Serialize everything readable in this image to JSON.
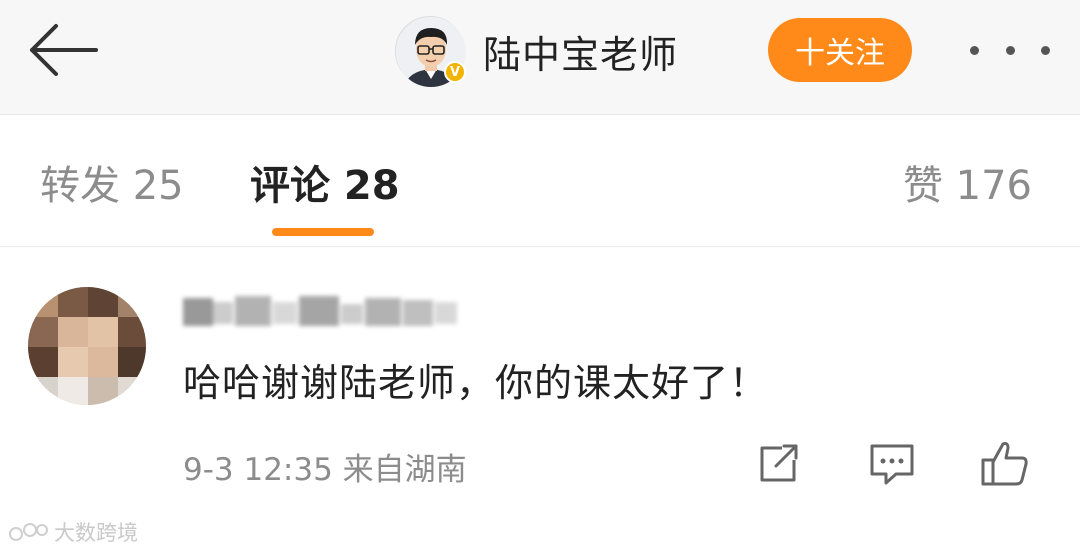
{
  "header": {
    "back_icon": "arrow-left-icon",
    "author_name": "陆中宝老师",
    "verified_badge": "V",
    "follow_label": "十关注",
    "more_icon": "more-dots-icon",
    "accent_color": "#ff8a1a"
  },
  "tabs": {
    "repost": "转发 25",
    "comment": "评论 28",
    "like": "赞 176",
    "active": "comment"
  },
  "comment": {
    "text": "哈哈谢谢陆老师，你的课太好了！",
    "meta": "9-3 12:35 来自湖南",
    "actions": [
      "share-icon",
      "reply-icon",
      "thumbs-up-icon"
    ]
  },
  "watermark": "大数跨境"
}
